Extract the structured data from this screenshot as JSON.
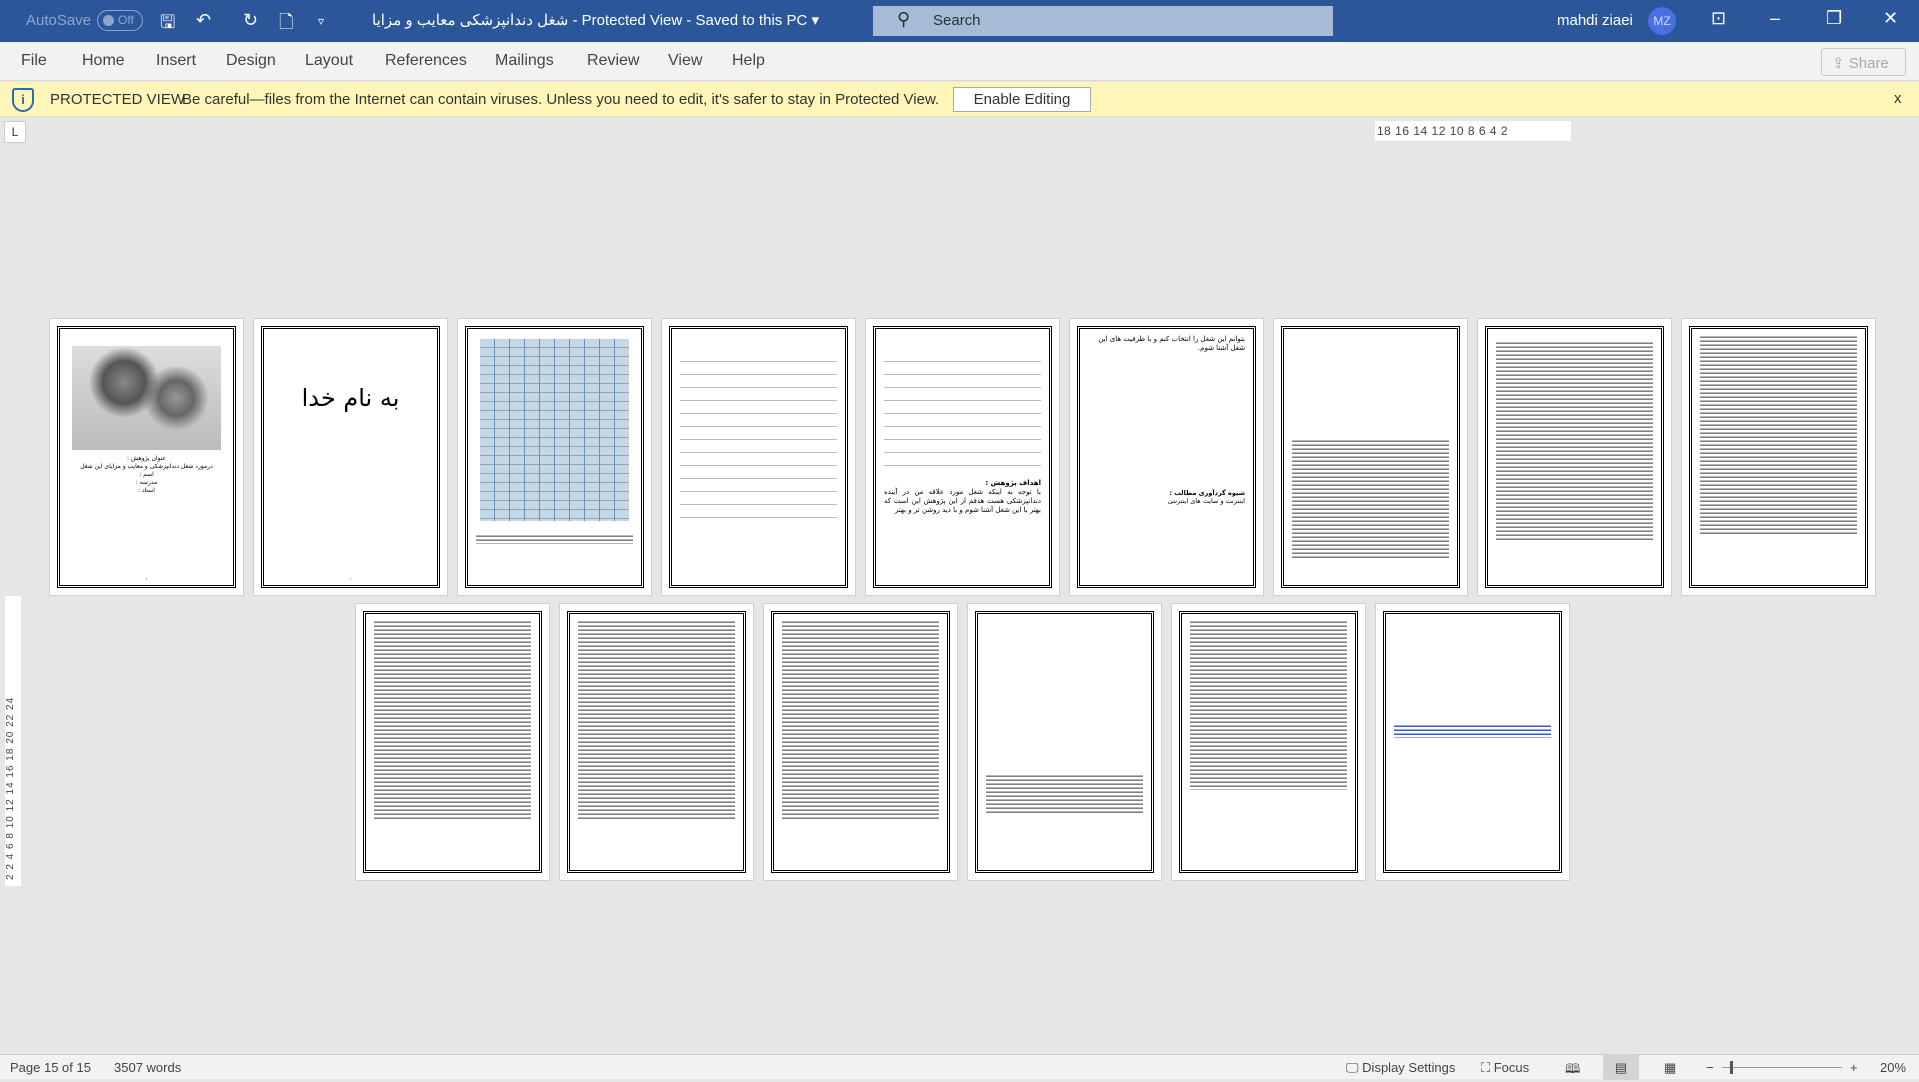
{
  "titlebar": {
    "autosave": "AutoSave",
    "autosave_state": "Off",
    "doc_title": "شغل دندانپزشکی معایب و مزایا  -  Protected View  -  Saved to this PC ▾",
    "search_placeholder": "Search",
    "user_name": "mahdi ziaei",
    "user_initials": "MZ"
  },
  "ribbon": {
    "tabs": [
      "File",
      "Home",
      "Insert",
      "Design",
      "Layout",
      "References",
      "Mailings",
      "Review",
      "View",
      "Help"
    ],
    "share": "Share"
  },
  "protected_view": {
    "label": "PROTECTED VIEW",
    "message": "Be careful—files from the Internet can contain viruses. Unless you need to edit, it's safer to stay in Protected View.",
    "button": "Enable Editing",
    "close": "x"
  },
  "ruler": {
    "horizontal": "18 16 14 12 10 8 6 4 2",
    "vertical": "2 2 4 6 8 10 12 14 16 18 20 22 24"
  },
  "pages": {
    "p1": {
      "title": "عنوان پژوهش :",
      "subtitle": "درمورد شغل دندانپزشکی و معایب و مزایای این شغل",
      "lines": [
        "اسم :",
        "مدرسه :",
        "استاد :"
      ],
      "num": "1"
    },
    "p2": {
      "text": "به نام خدا",
      "num": "2"
    },
    "p5": {
      "heading": "اهداف پژوهش :",
      "body": "با توجه به اینکه شغل مورد علاقه من در آینده دندانپزشکی هست هدفم از این پژوهش این است که بهتر با این شغل آشنا شوم و با دید روشن تر و بهتر"
    },
    "p6": {
      "top": "بتوانم این شغل را انتخاب کنم و با ظرفیت های این شغل آشنا شوم.",
      "heading": "شیوه گردآوری مطالب :",
      "body": "اینترنت و سایت های اینترنتی"
    }
  },
  "status": {
    "page": "Page 15 of 15",
    "words": "3507 words",
    "display_settings": "Display Settings",
    "focus": "Focus",
    "zoom": "20%"
  },
  "colors": {
    "titlebar": "#2b579a",
    "protected_bar": "#fdf6b8"
  }
}
